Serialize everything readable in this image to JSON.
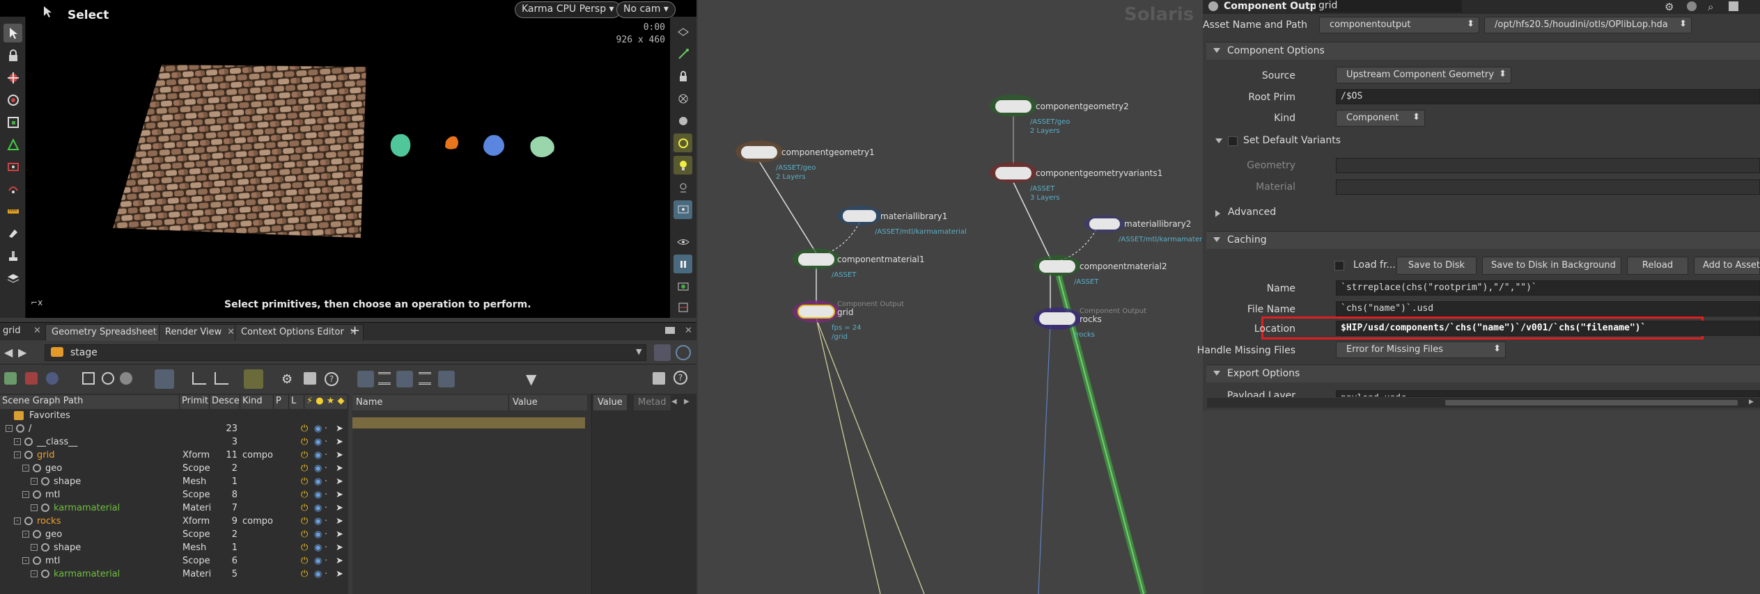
{
  "viewport": {
    "tool_name": "Select",
    "renderer": "Karma CPU",
    "camera_view": "Persp",
    "cam_menu": "No cam",
    "time": "0:00",
    "resolution": "926 x 460",
    "hint": "Select primitives, then choose an operation to perform.",
    "axis_label": "x"
  },
  "bottom_tabs": {
    "pane_name": "grid",
    "tabs": [
      "Geometry Spreadsheet",
      "Render View",
      "Context Options Editor"
    ],
    "add": "+"
  },
  "path": {
    "label": "stage"
  },
  "scene_graph": {
    "columns": [
      "Scene Graph Path",
      "Primit",
      "Desce",
      "Kind",
      "P",
      "L"
    ],
    "favorites_label": "Favorites",
    "rows": [
      {
        "indent": 0,
        "name": "/",
        "prim": "",
        "desc": "23",
        "kind": "",
        "color": "#ddd"
      },
      {
        "indent": 1,
        "name": "__class__",
        "prim": "",
        "desc": "3",
        "kind": "",
        "color": "#ddd"
      },
      {
        "indent": 1,
        "name": "grid",
        "prim": "Xform",
        "desc": "11",
        "kind": "compo",
        "color": "#f0a030"
      },
      {
        "indent": 2,
        "name": "geo",
        "prim": "Scope",
        "desc": "2",
        "kind": "",
        "color": "#ddd"
      },
      {
        "indent": 3,
        "name": "shape",
        "prim": "Mesh",
        "desc": "1",
        "kind": "",
        "color": "#ddd"
      },
      {
        "indent": 2,
        "name": "mtl",
        "prim": "Scope",
        "desc": "8",
        "kind": "",
        "color": "#ddd"
      },
      {
        "indent": 3,
        "name": "karmamaterial",
        "prim": "Materi",
        "desc": "7",
        "kind": "",
        "color": "#6fbf3f"
      },
      {
        "indent": 1,
        "name": "rocks",
        "prim": "Xform",
        "desc": "9",
        "kind": "compo",
        "color": "#f0a030"
      },
      {
        "indent": 2,
        "name": "geo",
        "prim": "Scope",
        "desc": "2",
        "kind": "",
        "color": "#ddd"
      },
      {
        "indent": 3,
        "name": "shape",
        "prim": "Mesh",
        "desc": "1",
        "kind": "",
        "color": "#ddd"
      },
      {
        "indent": 2,
        "name": "mtl",
        "prim": "Scope",
        "desc": "6",
        "kind": "",
        "color": "#ddd"
      },
      {
        "indent": 3,
        "name": "karmamaterial",
        "prim": "Materi",
        "desc": "5",
        "kind": "",
        "color": "#6fbf3f"
      }
    ]
  },
  "properties": {
    "name_col": "Name",
    "value_col": "Value",
    "value_tab": "Value",
    "metadata_tab": "Metad"
  },
  "network": {
    "context_label": "Solaris",
    "nodes": [
      {
        "name": "componentgeometry1",
        "sub1": "/ASSET/geo",
        "sub2": "2 Layers"
      },
      {
        "name": "materiallibrary1",
        "sub1": "/ASSET/mtl/karmamaterial",
        "sub2": ""
      },
      {
        "name": "componentmaterial1",
        "sub1": "/ASSET",
        "sub2": ""
      },
      {
        "name": "grid",
        "type": "Component Output",
        "sub1": "fps = 24",
        "sub2": "/grid"
      },
      {
        "name": "componentgeometry2",
        "sub1": "/ASSET/geo",
        "sub2": "2 Layers"
      },
      {
        "name": "componentgeometryvariants1",
        "sub1": "/ASSET",
        "sub2": "3 Layers"
      },
      {
        "name": "materiallibrary2",
        "sub1": "/ASSET/mtl/karmamaterial",
        "sub2": ""
      },
      {
        "name": "componentmaterial2",
        "sub1": "/ASSET",
        "sub2": ""
      },
      {
        "name": "rocks",
        "type": "Component Output",
        "sub1": "/rocks",
        "sub2": ""
      }
    ]
  },
  "params": {
    "node_type": "Component Output",
    "node_name": "grid",
    "asset_label": "Asset Name and Path",
    "asset_name": "componentoutput",
    "asset_path": "/opt/hfs20.5/houdini/otls/OPlibLop.hda",
    "sections": {
      "component_options": "Component Options",
      "advanced": "Advanced",
      "caching": "Caching",
      "export_options": "Export Options"
    },
    "source_label": "Source",
    "source_value": "Upstream Component Geometry",
    "root_prim_label": "Root Prim",
    "root_prim_value": "/$OS",
    "kind_label": "Kind",
    "kind_value": "Component",
    "set_default_variants": "Set Default Variants",
    "geometry_label": "Geometry",
    "material_label": "Material",
    "load_from_label": "Load fr...",
    "save_to_disk": "Save to Disk",
    "save_bg": "Save to Disk in Background",
    "reload": "Reload",
    "add_to_asset": "Add to Asset",
    "name_label": "Name",
    "name_value": "`strreplace(chs(\"rootprim\"),\"/\",\"\")`",
    "filename_label": "File Name",
    "filename_value": "`chs(\"name\")`.usd",
    "location_label": "Location",
    "location_value": "$HIP/usd/components/`chs(\"name\")`/v001/`chs(\"filename\")`",
    "missing_label": "Handle Missing Files",
    "missing_value": "Error for Missing Files",
    "payload_label": "Payload Layer",
    "payload_value": "payload.usdc"
  },
  "colors": {
    "highlight": "#e02020",
    "accent": "#f0a030"
  }
}
